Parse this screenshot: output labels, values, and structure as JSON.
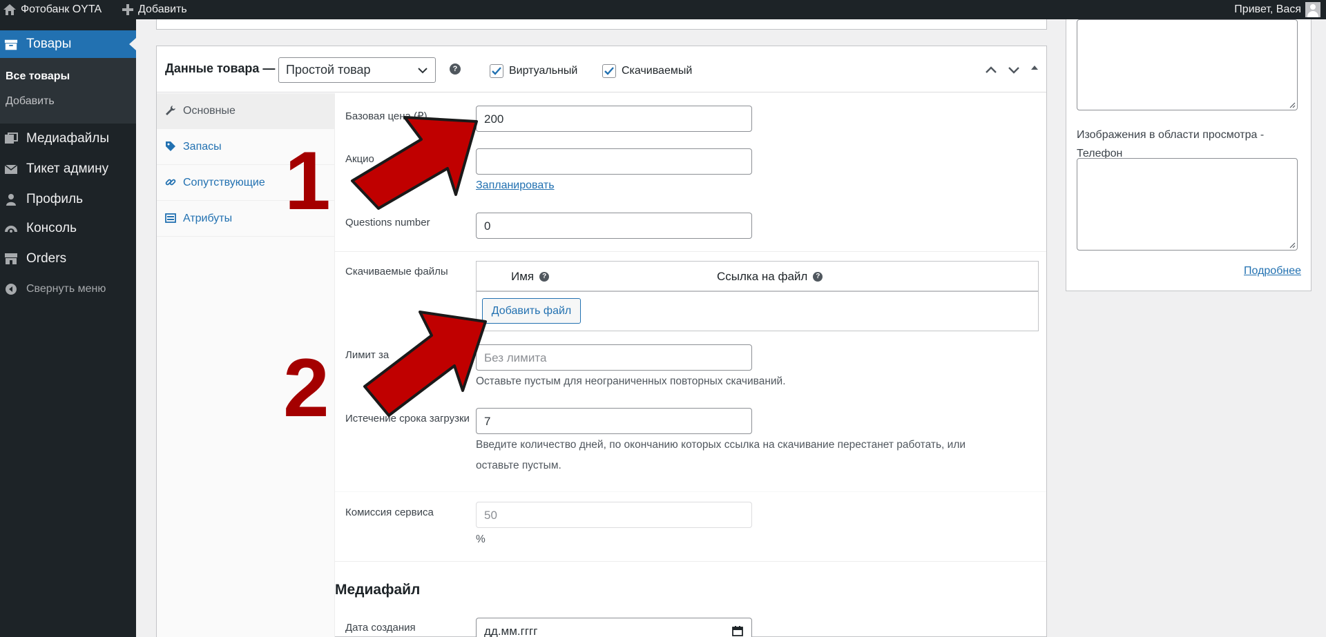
{
  "adminbar": {
    "site_name": "Фотобанк OYTA",
    "new_label": "Добавить",
    "greeting": "Привет, Вася"
  },
  "menu": {
    "current": "Товары",
    "submenu": [
      "Все товары",
      "Добавить"
    ],
    "items": [
      "Медиафайлы",
      "Тикет админу",
      "Профиль",
      "Консоль",
      "Orders"
    ],
    "collapse": "Свернуть меню"
  },
  "product_data": {
    "title": "Данные товара —",
    "type_value": "Простой товар",
    "virtual_label": "Виртуальный",
    "downloadable_label": "Скачиваемый",
    "virtual_checked": true,
    "downloadable_checked": true,
    "tabs": [
      "Основные",
      "Запасы",
      "Сопутствующие",
      "Атрибуты"
    ],
    "active_tab": "Основные"
  },
  "general": {
    "regular_price_label": "Базовая цена (₽)",
    "regular_price_value": "200",
    "sale_price_label": "Акцио",
    "sale_price_value": "",
    "schedule_link": "Запланировать",
    "questions_label": "Questions number",
    "questions_value": "0",
    "downloadable_files_label": "Скачиваемые файлы",
    "col_name": "Имя",
    "col_url": "Ссылка на файл",
    "add_file_button": "Добавить файл",
    "download_limit_label": "Лимит за",
    "download_limit_placeholder": "Без лимита",
    "download_limit_desc": "Оставьте пустым для неограниченных повторных скачиваний.",
    "expiry_label": "Истечение срока загрузки",
    "expiry_value": "7",
    "expiry_desc_1": "Введите количество дней, по окончанию которых ссылка на скачивание перестанет работать, или",
    "expiry_desc_2": "оставьте пустым.",
    "commission_label": "Комиссия сервиса",
    "commission_value": "50",
    "commission_unit": "%"
  },
  "media": {
    "heading": "Медиафайл",
    "created_label": "Дата создания",
    "created_placeholder": "дд.мм.гггг"
  },
  "sidebar": {
    "phone_preview_label_1": "Изображения в области просмотра -",
    "phone_preview_label_2": "Телефон",
    "more_link": "Подробнее"
  },
  "annotations": {
    "marker_1": "1",
    "marker_2": "2",
    "arrow_color": "#c00000"
  },
  "colors": {
    "admin_dark": "#1d2327",
    "accent": "#2271b1"
  }
}
